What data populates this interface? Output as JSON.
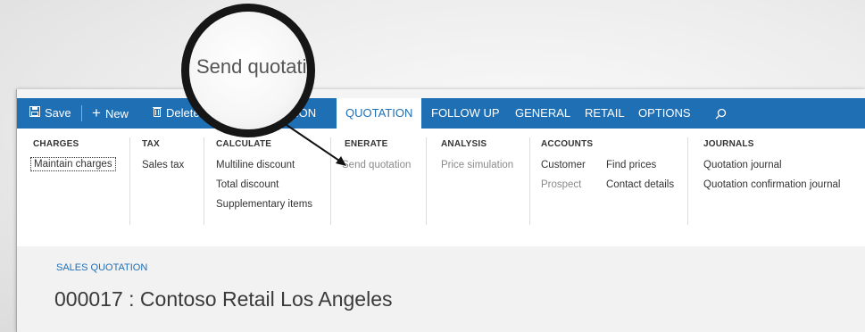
{
  "commandbar": {
    "save": "Save",
    "new": "New",
    "delete": "Delete",
    "tab_hidden": "ION",
    "tabs": [
      "QUOTATION",
      "FOLLOW UP",
      "GENERAL",
      "RETAIL",
      "OPTIONS"
    ],
    "save_icon": "save-icon",
    "new_icon": "plus-icon",
    "delete_icon": "trash-icon",
    "search_icon": "search-icon"
  },
  "ribbon": {
    "groups": [
      {
        "title": "CHARGES",
        "items": [
          "Maintain charges"
        ]
      },
      {
        "title": "TAX",
        "items": [
          "Sales tax"
        ]
      },
      {
        "title": "CALCULATE",
        "items": [
          "Multiline discount",
          "Total discount",
          "Supplementary items"
        ]
      },
      {
        "title": "ENERATE",
        "items": [
          "Send quotation"
        ]
      },
      {
        "title": "ANALYSIS",
        "items": [
          "Price simulation"
        ]
      },
      {
        "title": "ACCOUNTS",
        "items": [
          "Customer",
          "Prospect",
          "Find prices",
          "Contact details"
        ]
      },
      {
        "title": "JOURNALS",
        "items": [
          "Quotation journal",
          "Quotation confirmation journal"
        ]
      }
    ]
  },
  "page": {
    "breadcrumb": "SALES QUOTATION",
    "title": "000017 : Contoso Retail Los Angeles"
  },
  "magnifier": {
    "text": "Send quotation"
  },
  "colors": {
    "accent": "#1f6fb5",
    "disabled_text": "#8a8a8a"
  }
}
